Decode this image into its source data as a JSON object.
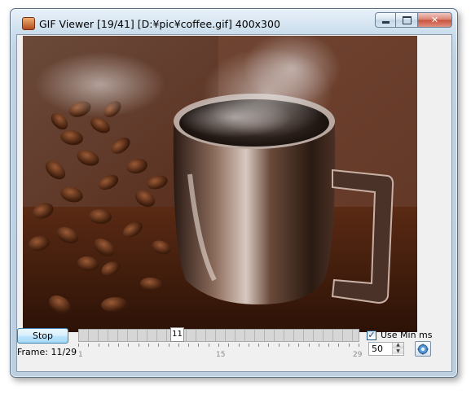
{
  "window": {
    "title": "GIF Viewer [19/41] [D:¥pic¥coffee.gif] 400x300",
    "app_icon": "gif-viewer-icon"
  },
  "caption_buttons": {
    "minimize_icon": "minimize-icon",
    "maximize_icon": "maximize-icon",
    "close_icon": "close-icon",
    "close_glyph": "✕"
  },
  "image": {
    "description_icon": "coffee-photo"
  },
  "controls": {
    "stop_label": "Stop",
    "frame_label": "Frame: 11/29",
    "slider_value": "11",
    "slider_fraction": 0.345,
    "tick_labels": [
      "1",
      "15",
      "29"
    ],
    "use_min_ms_label": "Use Min ms",
    "use_min_ms_checked": true,
    "check_glyph": "✓",
    "min_ms_value": "50",
    "spin_up": "▲",
    "spin_down": "▼",
    "settings_icon": "settings-icon"
  },
  "colors": {
    "accent": "#3c7fb1",
    "titlebar": "#c9dceb"
  }
}
